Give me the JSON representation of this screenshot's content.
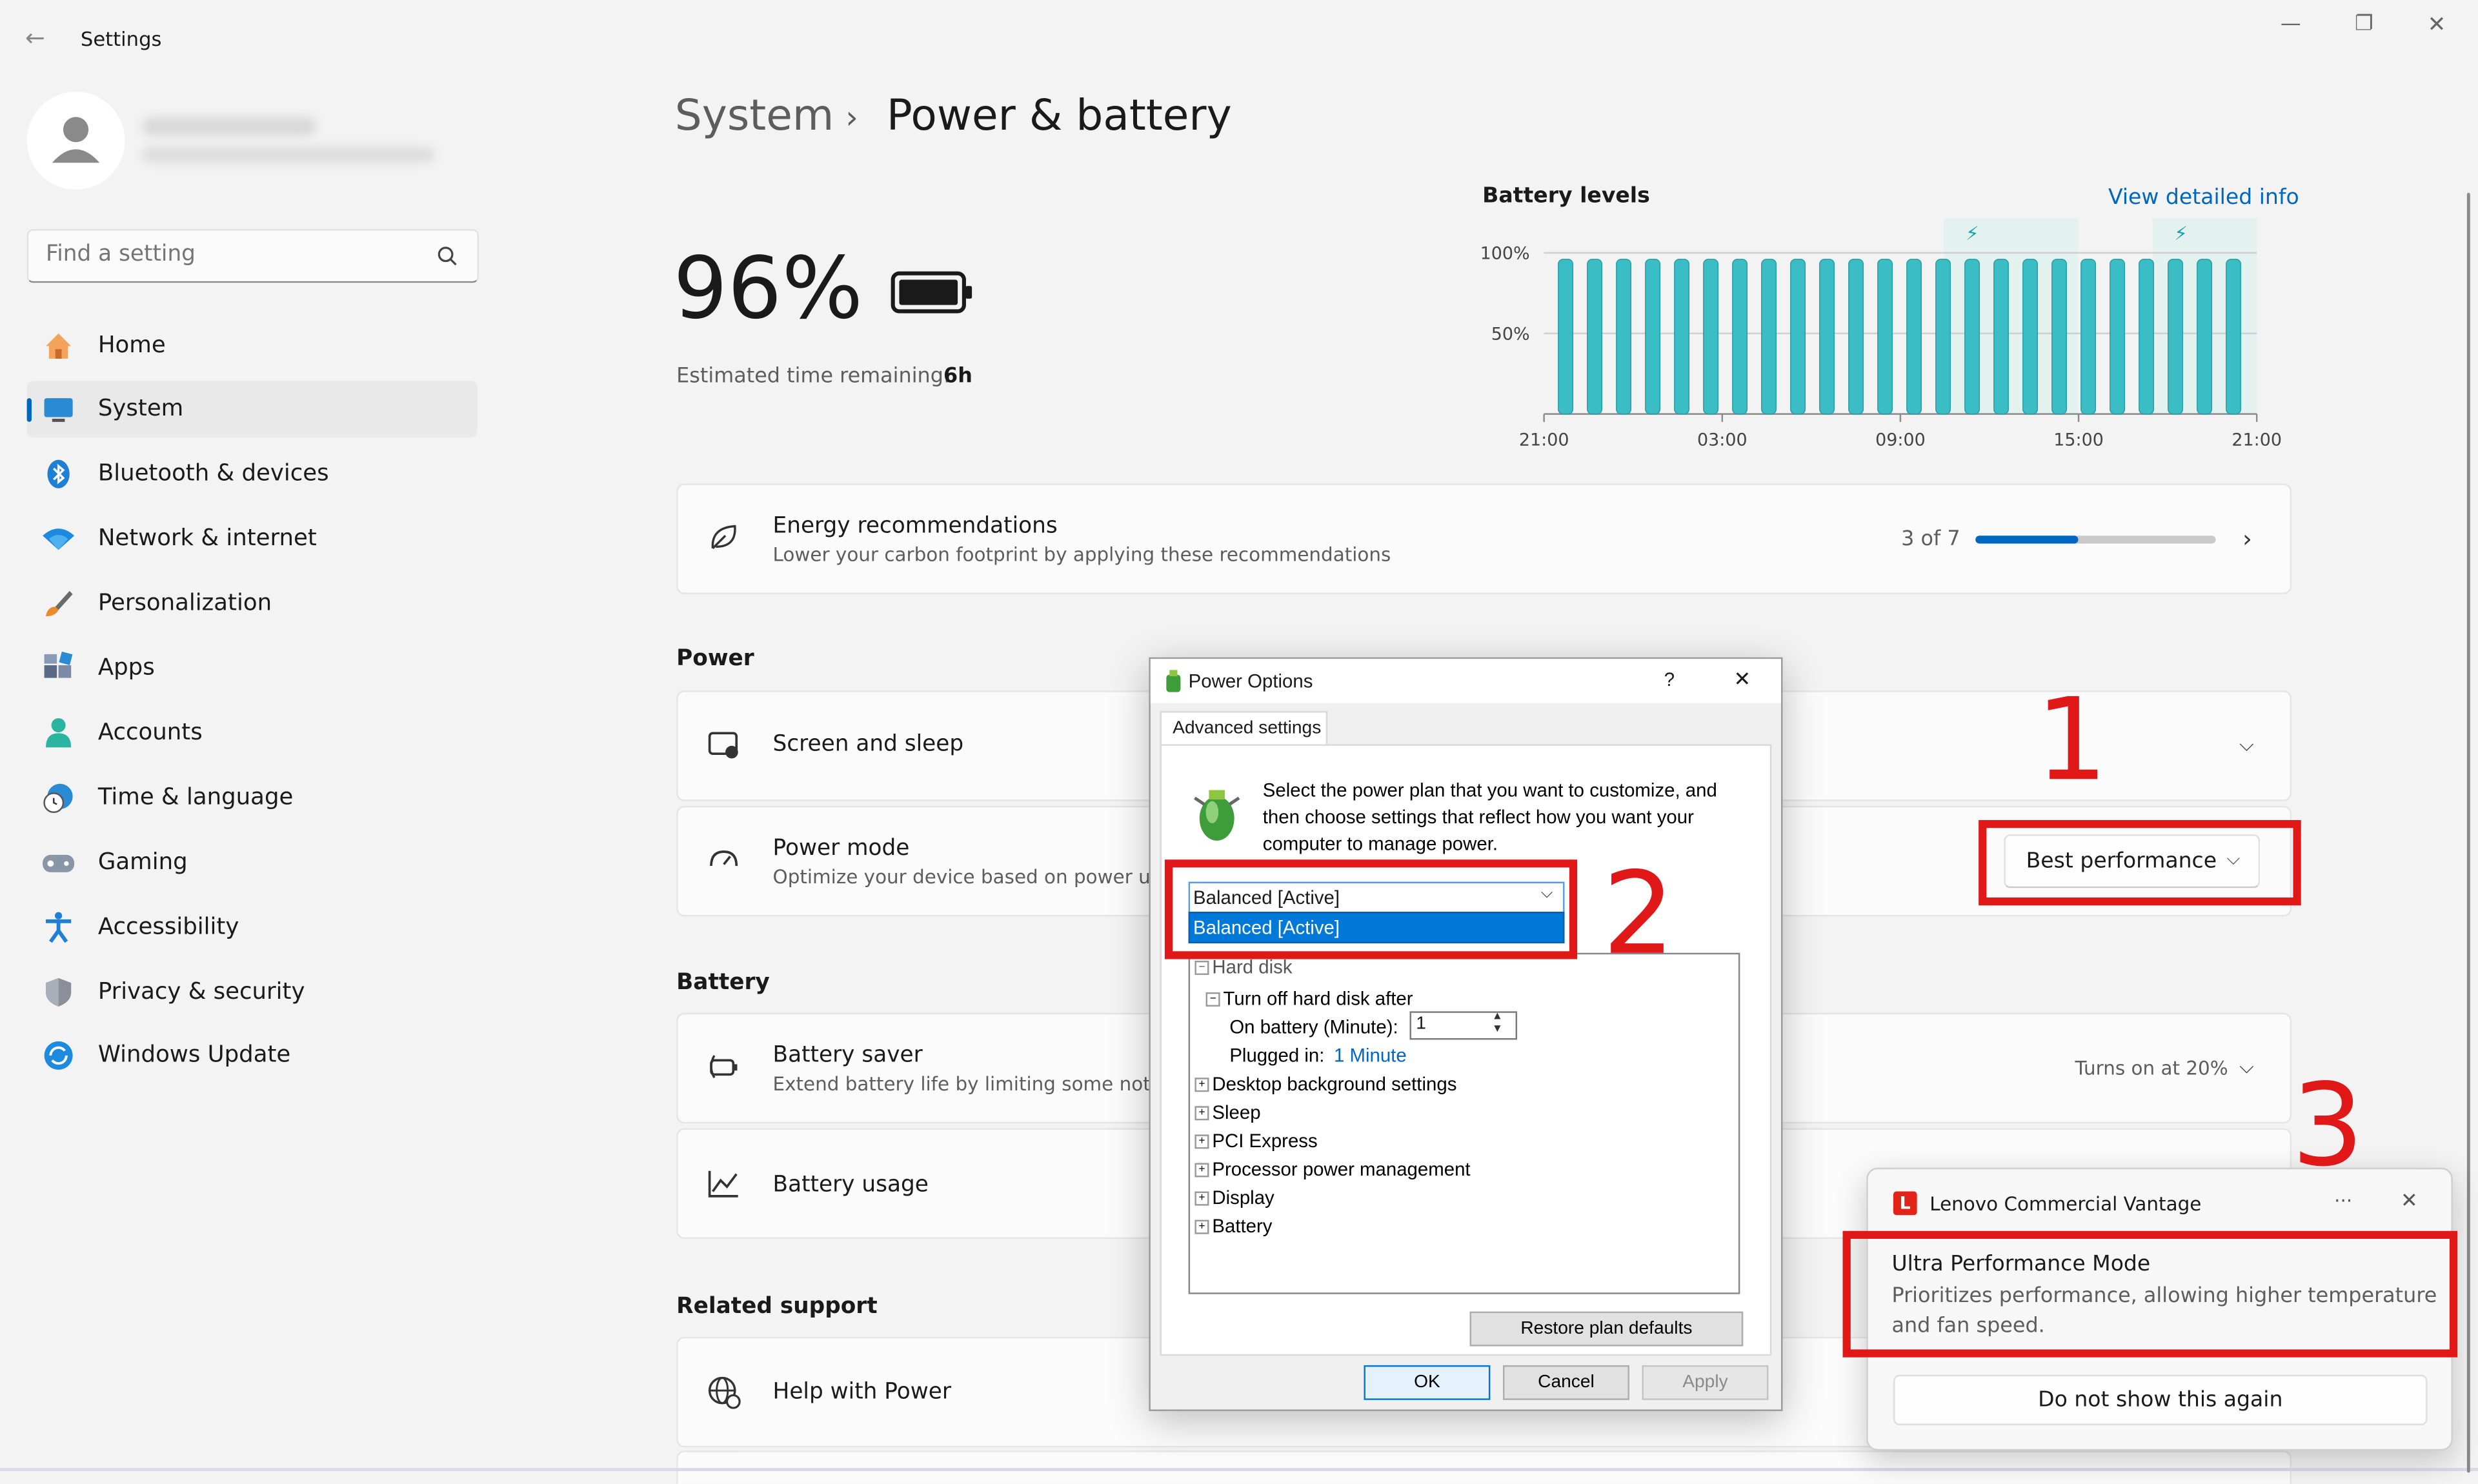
{
  "window": {
    "title": "Settings"
  },
  "sidebar": {
    "search_placeholder": "Find a setting",
    "items": [
      {
        "label": "Home",
        "icon": "home-icon"
      },
      {
        "label": "System",
        "icon": "system-icon"
      },
      {
        "label": "Bluetooth & devices",
        "icon": "bluetooth-icon"
      },
      {
        "label": "Network & internet",
        "icon": "wifi-icon"
      },
      {
        "label": "Personalization",
        "icon": "brush-icon"
      },
      {
        "label": "Apps",
        "icon": "apps-icon"
      },
      {
        "label": "Accounts",
        "icon": "person-icon"
      },
      {
        "label": "Time & language",
        "icon": "clock-icon"
      },
      {
        "label": "Gaming",
        "icon": "gamepad-icon"
      },
      {
        "label": "Accessibility",
        "icon": "accessibility-icon"
      },
      {
        "label": "Privacy & security",
        "icon": "shield-icon"
      },
      {
        "label": "Windows Update",
        "icon": "update-icon"
      }
    ]
  },
  "header": {
    "crumb_parent": "System",
    "separator": "›",
    "crumb_current": "Power & battery"
  },
  "battery": {
    "percent": "96%",
    "estimated_label": "Estimated time remaining:",
    "estimated_value": "6h"
  },
  "chart_data": {
    "type": "bar",
    "title": "Battery levels",
    "link": "View detailed info",
    "y_ticks": [
      "100%",
      "50%"
    ],
    "x_ticks": [
      "21:00",
      "03:00",
      "09:00",
      "15:00",
      "21:00"
    ],
    "ylim": [
      0,
      100
    ],
    "bar_color": "#3bbdc6",
    "values": [
      96,
      96,
      96,
      96,
      96,
      96,
      96,
      96,
      96,
      96,
      96,
      96,
      96,
      96,
      96,
      96,
      96,
      96,
      96,
      96,
      96,
      96,
      96,
      96
    ]
  },
  "energy": {
    "title": "Energy recommendations",
    "subtitle": "Lower your carbon footprint by applying these recommendations",
    "progress_text": "3 of 7",
    "progress": 0.43
  },
  "power": {
    "section": "Power",
    "screen_sleep": "Screen and sleep",
    "mode_title": "Power mode",
    "mode_sub": "Optimize your device based on power use a",
    "mode_value": "Best performance"
  },
  "battery_section": {
    "section": "Battery",
    "saver_title": "Battery saver",
    "saver_sub": "Extend battery life by limiting some notifica",
    "saver_value": "Turns on at 20%",
    "usage_title": "Battery usage"
  },
  "support": {
    "section": "Related support",
    "help": "Help with Power"
  },
  "dialog": {
    "title": "Power Options",
    "help": "?",
    "tab": "Advanced settings",
    "description": [
      "Select the power plan that you want to customize, and",
      "then choose settings that reflect how you want your",
      "computer to manage power."
    ],
    "plan_selected": "Balanced [Active]",
    "plan_option": "Balanced [Active]",
    "tree": {
      "hard_disk": "Hard disk",
      "turn_off": "Turn off hard disk after",
      "on_battery": "On battery (Minute):",
      "on_battery_value": "1",
      "plugged_in": "Plugged in:",
      "plugged_in_value": "1 Minute",
      "items": [
        "Desktop background settings",
        "Sleep",
        "PCI Express",
        "Processor power management",
        "Display",
        "Battery"
      ]
    },
    "restore": "Restore plan defaults",
    "ok": "OK",
    "cancel": "Cancel",
    "apply": "Apply"
  },
  "toast": {
    "app": "Lenovo Commercial Vantage",
    "more": "···",
    "heading": "Ultra Performance Mode",
    "body": [
      "Prioritizes performance, allowing higher temperature",
      "and fan speed."
    ],
    "button": "Do not show this again"
  },
  "annotations": {
    "n1": "1",
    "n2": "2",
    "n3": "3",
    "color": "#e01818"
  }
}
